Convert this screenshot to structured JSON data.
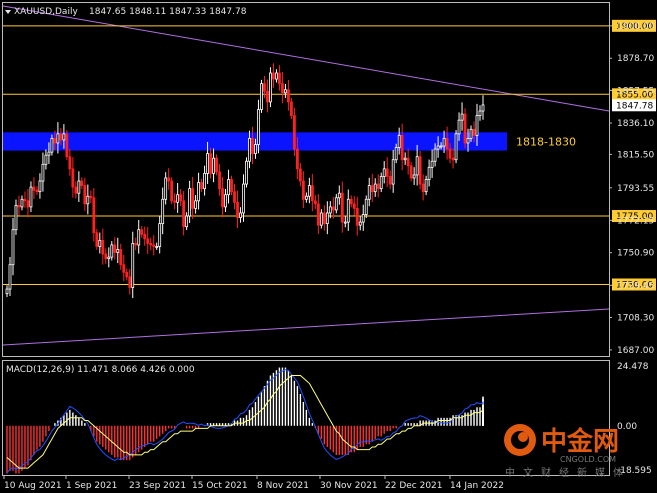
{
  "chart": {
    "symbol": "XAUUSD,Daily",
    "ohlc": "1847.65 1848.11 1847.33 1847.78",
    "current_price": "1847.78",
    "zone_label": "1818-1830",
    "macd_label": "MACD(12,26,9) 11.471 8.066 4.426 0.000",
    "macd_axis": [
      "24.478",
      "0.00",
      "-18.595"
    ],
    "colors": {
      "background": "#000000",
      "bull": "#ffffff",
      "bear": "#ff2020",
      "level": "#ffcc33",
      "zone": "#0a14ff",
      "trend": "#b070e0",
      "macd_hist_pos": "#ffffff",
      "macd_hist_neg": "#ff3030",
      "macd_line": "#2050ff",
      "signal_line": "#ffff80"
    }
  },
  "chart_data": {
    "type": "candlestick",
    "title": "XAUUSD,Daily",
    "ylim": [
      1683,
      1915
    ],
    "y_ticks": [
      "1900.00",
      "1878.70",
      "1857.55",
      "1836.10",
      "1815.50",
      "1793.55",
      "1772.15",
      "1750.90",
      "1729.45",
      "1708.30",
      "1687.00"
    ],
    "x_ticks": [
      "10 Aug 2021",
      "1 Sep 2021",
      "23 Sep 2021",
      "15 Oct 2021",
      "8 Nov 2021",
      "30 Nov 2021",
      "22 Dec 2021",
      "14 Jan 2022"
    ],
    "levels": [
      "1900.00",
      "1855.00",
      "1775.00",
      "1730.00"
    ],
    "zone": [
      1818,
      1830
    ],
    "close": [
      1727,
      1743,
      1766,
      1782,
      1781,
      1786,
      1785,
      1781,
      1794,
      1792,
      1791,
      1798,
      1809,
      1815,
      1817,
      1826,
      1823,
      1829,
      1825,
      1829,
      1814,
      1806,
      1794,
      1790,
      1798,
      1795,
      1783,
      1788,
      1787,
      1764,
      1755,
      1759,
      1750,
      1747,
      1748,
      1756,
      1751,
      1753,
      1743,
      1738,
      1735,
      1728,
      1757,
      1756,
      1766,
      1763,
      1760,
      1757,
      1756,
      1755,
      1755,
      1770,
      1786,
      1800,
      1798,
      1785,
      1784,
      1789,
      1785,
      1768,
      1775,
      1793,
      1780,
      1785,
      1797,
      1793,
      1803,
      1816,
      1803,
      1813,
      1804,
      1793,
      1781,
      1789,
      1799,
      1791,
      1784,
      1774,
      1777,
      1796,
      1811,
      1826,
      1816,
      1822,
      1845,
      1862,
      1857,
      1850,
      1869,
      1865,
      1869,
      1862,
      1856,
      1858,
      1850,
      1841,
      1819,
      1806,
      1798,
      1786,
      1788,
      1795,
      1785,
      1783,
      1769,
      1777,
      1770,
      1777,
      1781,
      1779,
      1787,
      1790,
      1771,
      1771,
      1786,
      1783,
      1780,
      1769,
      1771,
      1776,
      1786,
      1795,
      1791,
      1796,
      1793,
      1801,
      1806,
      1801,
      1796,
      1812,
      1820,
      1828,
      1812,
      1813,
      1808,
      1800,
      1802,
      1814,
      1796,
      1791,
      1799,
      1807,
      1811,
      1819,
      1821,
      1821,
      1826,
      1819,
      1813,
      1812,
      1829,
      1838,
      1842,
      1823,
      1826,
      1832,
      1828,
      1841,
      1844,
      1848
    ],
    "macd": [
      -18,
      -17,
      -17,
      -18,
      -18,
      -17,
      -16,
      -15,
      -13,
      -11,
      -9,
      -8,
      -6,
      -4,
      -2,
      0,
      1,
      2,
      3,
      4,
      5,
      6,
      5,
      4,
      3,
      2,
      1,
      0,
      -2,
      -4,
      -6,
      -7,
      -8,
      -9,
      -10,
      -11,
      -12,
      -12,
      -13,
      -13,
      -13,
      -13,
      -12,
      -11,
      -10,
      -9,
      -8,
      -7,
      -6,
      -6,
      -5,
      -4,
      -3,
      -2,
      -1,
      -1,
      -1,
      0,
      0,
      0,
      -1,
      -1,
      -1,
      -1,
      -1,
      0,
      0,
      1,
      1,
      1,
      1,
      1,
      1,
      1,
      1,
      1,
      2,
      2,
      3,
      3,
      4,
      6,
      7,
      9,
      11,
      13,
      15,
      17,
      19,
      20,
      21,
      22,
      22,
      22,
      21,
      19,
      17,
      15,
      12,
      9,
      6,
      3,
      1,
      -1,
      -3,
      -5,
      -7,
      -8,
      -9,
      -10,
      -11,
      -11,
      -11,
      -11,
      -11,
      -10,
      -10,
      -9,
      -8,
      -8,
      -7,
      -7,
      -6,
      -5,
      -4,
      -4,
      -3,
      -2,
      -2,
      -1,
      -1,
      0,
      0,
      1,
      1,
      1,
      1,
      1,
      2,
      2,
      2,
      2,
      2,
      2,
      3,
      3,
      3,
      3,
      3,
      4,
      4,
      4,
      4,
      5,
      5,
      6,
      6,
      7,
      7,
      8,
      8,
      9,
      9,
      10,
      10,
      11,
      11
    ],
    "signal": [
      -12,
      -13,
      -14,
      -15,
      -16,
      -16,
      -16,
      -16,
      -15,
      -14,
      -13,
      -12,
      -11,
      -9,
      -7,
      -5,
      -3,
      -1,
      0,
      1,
      2,
      3,
      3,
      3,
      3,
      3,
      2,
      2,
      1,
      0,
      -1,
      -2,
      -3,
      -4,
      -5,
      -6,
      -7,
      -8,
      -9,
      -10,
      -10,
      -11,
      -11,
      -11,
      -11,
      -11,
      -10,
      -10,
      -9,
      -9,
      -8,
      -7,
      -6,
      -6,
      -5,
      -4,
      -3,
      -3,
      -2,
      -2,
      -2,
      -2,
      -2,
      -1,
      -1,
      -1,
      -1,
      -1,
      0,
      0,
      0,
      0,
      0,
      0,
      0,
      0,
      1,
      1,
      1,
      1,
      2,
      2,
      3,
      4,
      5,
      6,
      7,
      9,
      10,
      12,
      13,
      15,
      16,
      17,
      18,
      19,
      19,
      19,
      19,
      18,
      17,
      16,
      14,
      12,
      10,
      8,
      6,
      4,
      2,
      0,
      -2,
      -3,
      -5,
      -6,
      -7,
      -8,
      -8,
      -9,
      -9,
      -9,
      -9,
      -9,
      -8,
      -8,
      -7,
      -7,
      -6,
      -5,
      -5,
      -4,
      -3,
      -3,
      -2,
      -2,
      -1,
      -1,
      0,
      0,
      0,
      1,
      1,
      1,
      1,
      1,
      2,
      2,
      2,
      2,
      2,
      3,
      3,
      3,
      3,
      4,
      4,
      4,
      5,
      5,
      5,
      6,
      6,
      7,
      7,
      8,
      8,
      8
    ]
  },
  "watermark": {
    "brand": "中金网",
    "domain": "CNGOLD.COM",
    "tagline": "中文财经新媒体"
  }
}
